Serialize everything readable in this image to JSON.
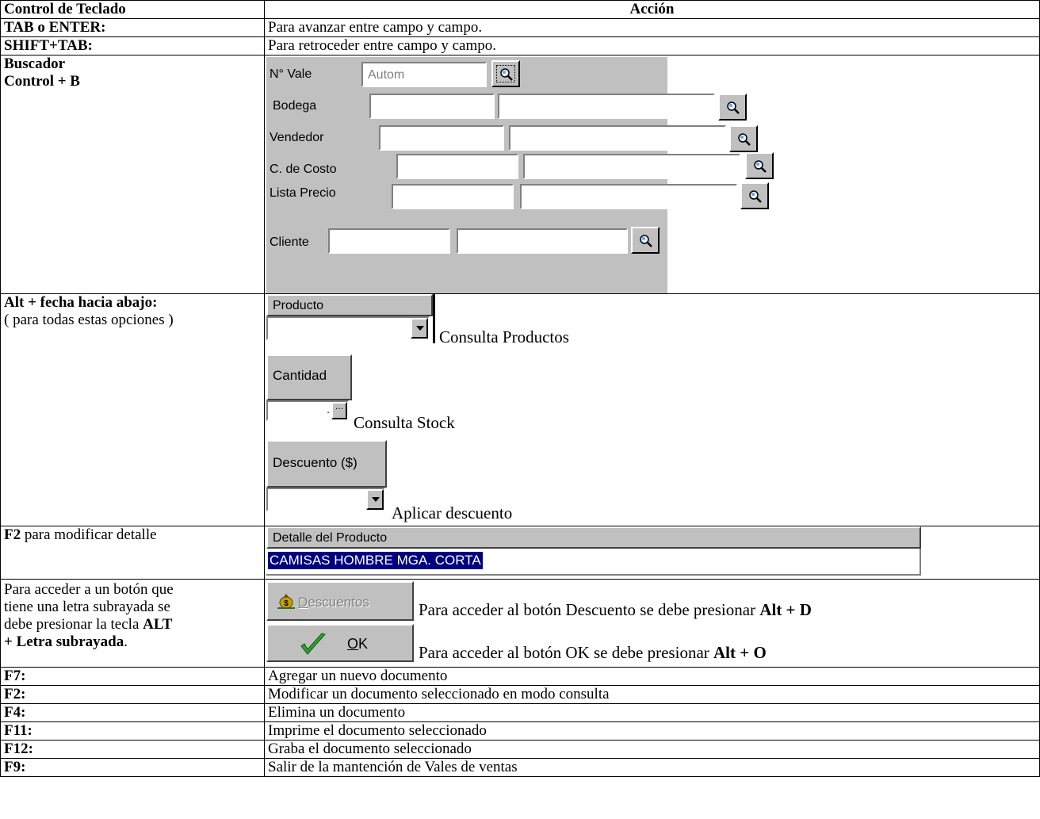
{
  "header": {
    "col1": "Control de Teclado",
    "col2": "Acción"
  },
  "rows_top": [
    {
      "key": "TAB o ENTER:",
      "action": "Para avanzar entre campo y campo."
    },
    {
      "key": "SHIFT+TAB:",
      "action": "Para retroceder entre campo y campo."
    }
  ],
  "buscador": {
    "key_line1": "Buscador",
    "key_line2": "Control + B",
    "form": {
      "nvale_label": "N° Vale",
      "nvale_value": "Autom",
      "bodega_label": "Bodega",
      "vendedor_label": "Vendedor",
      "costo_label": "C. de Costo",
      "lista_label": "Lista Precio",
      "cliente_label": "Cliente"
    }
  },
  "alt": {
    "key": "Alt + fecha hacia abajo:",
    "note": "( para todas estas opciones )",
    "producto_header": "Producto",
    "producto_caption": "Consulta Productos",
    "cantidad_header": "Cantidad",
    "cantidad_value": ".",
    "cantidad_caption": "Consulta Stock",
    "descuento_header": "Descuento ($)",
    "descuento_caption": "Aplicar descuento"
  },
  "f2": {
    "key_bold": "F2",
    "key_rest": " para modificar detalle",
    "detail_header": "Detalle del Producto",
    "detail_value": "CAMISAS HOMBRE MGA. CORTA"
  },
  "alt_letter": {
    "text_line1": "Para acceder a un botón que",
    "text_line2": "tiene una letra subrayada se",
    "text_line3_plain": "debe presionar la tecla ",
    "text_line3_bold": "ALT",
    "text_line4_bold": "+ Letra subrayada",
    "text_line4_end": ".",
    "descuentos_button": "Descuentos",
    "descuentos_caption_plain": "Para acceder al botón Descuento se debe presionar ",
    "descuentos_caption_bold": "Alt + D",
    "ok_button": "OK",
    "ok_caption_plain": "Para acceder al botón OK se debe presionar ",
    "ok_caption_bold": "Alt + O"
  },
  "rows_bottom": [
    {
      "key": "F7:",
      "action": "Agregar un nuevo documento"
    },
    {
      "key": "F2:",
      "action": "Modificar un documento seleccionado en modo consulta"
    },
    {
      "key": "F4:",
      "action": "Elimina un documento"
    },
    {
      "key": "F11:",
      "action": "Imprime el documento seleccionado"
    },
    {
      "key": "F12:",
      "action": "Graba el documento seleccionado"
    },
    {
      "key": "F9:",
      "action": "Salir de la mantención de Vales de ventas"
    }
  ],
  "colors": {
    "form_gray": "#c0c0c0",
    "highlight": "#000080",
    "highlight_text": "#ffffff"
  }
}
